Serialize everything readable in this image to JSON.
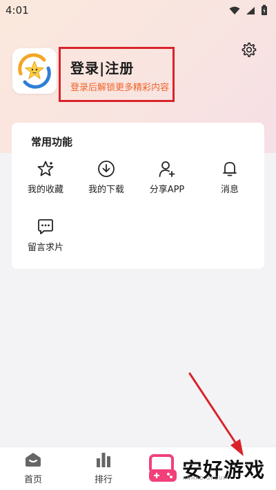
{
  "status_bar": {
    "time": "4:01"
  },
  "profile": {
    "title": "登录|注册",
    "subtitle": "登录后解锁更多精彩内容"
  },
  "card": {
    "title": "常用功能",
    "features": [
      {
        "label": "我的收藏",
        "icon": "star-icon"
      },
      {
        "label": "我的下载",
        "icon": "download-icon"
      },
      {
        "label": "分享APP",
        "icon": "share-user-icon"
      },
      {
        "label": "消息",
        "icon": "bell-icon"
      },
      {
        "label": "留言求片",
        "icon": "message-icon"
      }
    ]
  },
  "tabbar": {
    "tabs": [
      {
        "label": "首页",
        "icon": "home-icon"
      },
      {
        "label": "排行",
        "icon": "ranking-icon"
      }
    ]
  },
  "watermark": {
    "text": "安好游戏",
    "sub": "ANHAO GROUP"
  },
  "colors": {
    "accent_red": "#d9232b",
    "subtitle_orange": "#f0642a"
  }
}
